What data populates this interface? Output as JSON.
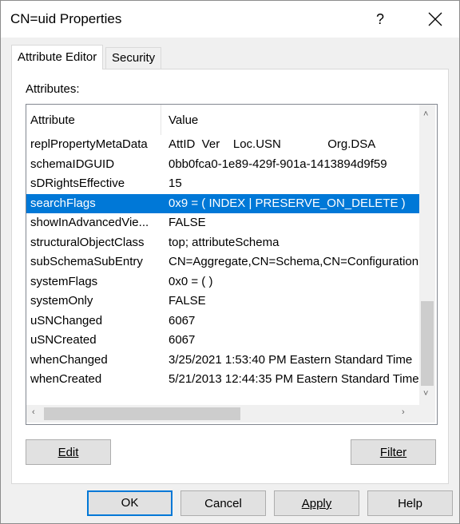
{
  "window": {
    "title": "CN=uid Properties",
    "help": "?"
  },
  "tabs": [
    {
      "label": "Attribute Editor",
      "active": true
    },
    {
      "label": "Security",
      "active": false
    }
  ],
  "attributes_label": "Attributes:",
  "columns": {
    "attribute": "Attribute",
    "value": "Value"
  },
  "rows": [
    {
      "attribute": "replPropertyMetaData",
      "value": "AttID  Ver    Loc.USN              Org.DSA"
    },
    {
      "attribute": "schemaIDGUID",
      "value": "0bb0fca0-1e89-429f-901a-1413894d9f59"
    },
    {
      "attribute": "sDRightsEffective",
      "value": "15"
    },
    {
      "attribute": "searchFlags",
      "value": "0x9 = ( INDEX | PRESERVE_ON_DELETE )",
      "selected": true
    },
    {
      "attribute": "showInAdvancedVie...",
      "value": "FALSE"
    },
    {
      "attribute": "structuralObjectClass",
      "value": "top; attributeSchema"
    },
    {
      "attribute": "subSchemaSubEntry",
      "value": "CN=Aggregate,CN=Schema,CN=Configuration"
    },
    {
      "attribute": "systemFlags",
      "value": "0x0 = ( )"
    },
    {
      "attribute": "systemOnly",
      "value": "FALSE"
    },
    {
      "attribute": "uSNChanged",
      "value": "6067"
    },
    {
      "attribute": "uSNCreated",
      "value": "6067"
    },
    {
      "attribute": "whenChanged",
      "value": "3/25/2021 1:53:40 PM Eastern Standard Time"
    },
    {
      "attribute": "whenCreated",
      "value": "5/21/2013 12:44:35 PM Eastern Standard Time"
    }
  ],
  "buttons": {
    "edit": "Edit",
    "filter": "Filter",
    "ok": "OK",
    "cancel": "Cancel",
    "apply": "Apply",
    "help": "Help"
  },
  "colors": {
    "selection": "#0078d7",
    "default_button_border": "#0078d7"
  },
  "icons": {
    "close": "close-icon",
    "scroll_up": "chevron-up-icon",
    "scroll_down": "chevron-down-icon",
    "scroll_left": "chevron-left-icon",
    "scroll_right": "chevron-right-icon"
  }
}
